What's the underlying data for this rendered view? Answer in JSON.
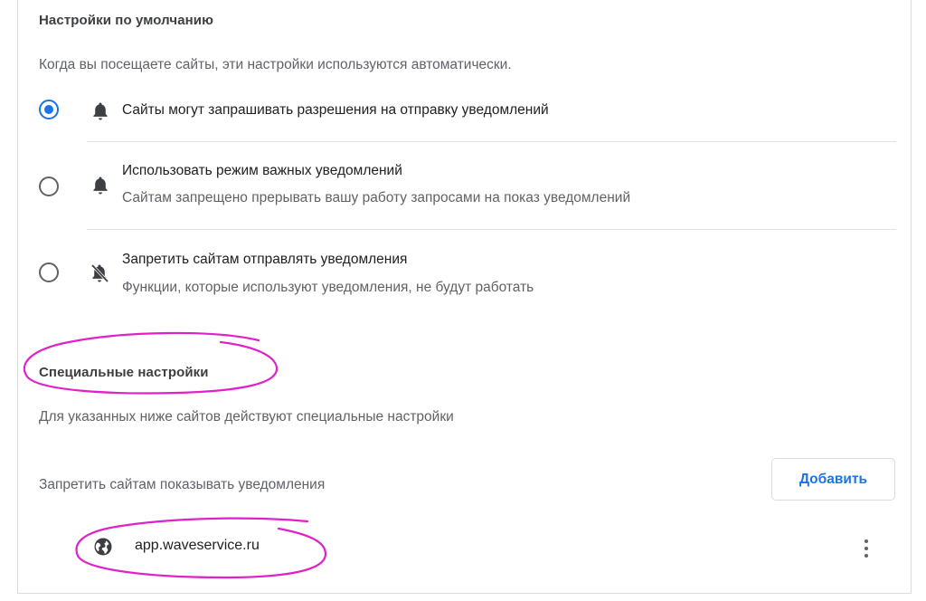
{
  "defaults": {
    "title": "Настройки по умолчанию",
    "description": "Когда вы посещаете сайты, эти настройки используются автоматически.",
    "options": [
      {
        "label": "Сайты могут запрашивать разрешения на отправку уведомлений",
        "sublabel": "",
        "selected": true,
        "icon": "bell-icon"
      },
      {
        "label": "Использовать режим важных уведомлений",
        "sublabel": "Сайтам запрещено прерывать вашу работу запросами на показ уведомлений",
        "selected": false,
        "icon": "bell-icon"
      },
      {
        "label": "Запретить сайтам отправлять уведомления",
        "sublabel": "Функции, которые используют уведомления, не будут работать",
        "selected": false,
        "icon": "bell-off-icon"
      }
    ]
  },
  "custom": {
    "title": "Специальные настройки",
    "description": "Для указанных ниже сайтов действуют специальные настройки",
    "blocked_label": "Запретить сайтам показывать уведомления",
    "add_button": "Добавить",
    "sites": [
      {
        "host": "app.waveservice.ru",
        "icon": "globe-icon"
      }
    ]
  },
  "colors": {
    "accent": "#1a73e8",
    "annotation": "#e020c8"
  }
}
